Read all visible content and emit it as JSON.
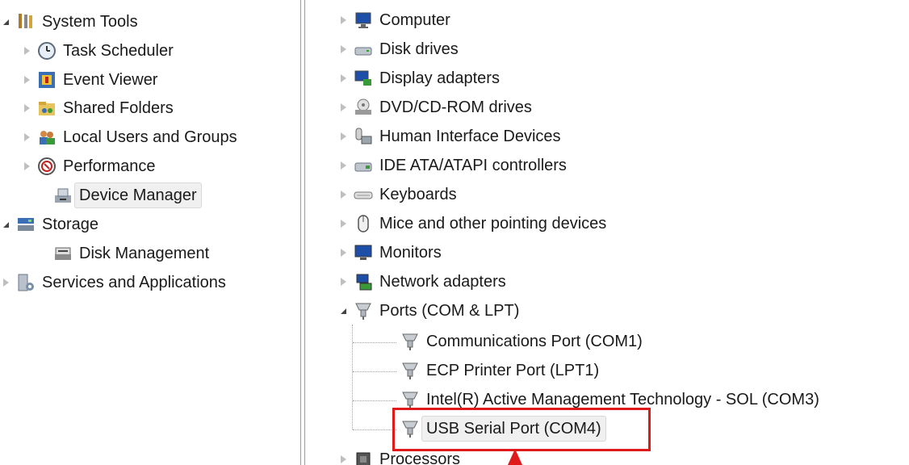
{
  "left_tree": {
    "items": [
      {
        "label": "System Tools",
        "icon": "toolbox-icon",
        "state": "expanded"
      },
      {
        "label": "Task Scheduler",
        "icon": "clock-icon",
        "state": "collapsed"
      },
      {
        "label": "Event Viewer",
        "icon": "event-viewer-icon",
        "state": "collapsed"
      },
      {
        "label": "Shared Folders",
        "icon": "shared-folder-icon",
        "state": "collapsed"
      },
      {
        "label": "Local Users and Groups",
        "icon": "users-icon",
        "state": "collapsed"
      },
      {
        "label": "Performance",
        "icon": "performance-icon",
        "state": "collapsed"
      },
      {
        "label": "Device Manager",
        "icon": "device-manager-icon",
        "state": "none",
        "selected": true
      },
      {
        "label": "Storage",
        "icon": "storage-icon",
        "state": "expanded"
      },
      {
        "label": "Disk Management",
        "icon": "disk-management-icon",
        "state": "none"
      },
      {
        "label": "Services and Applications",
        "icon": "services-icon",
        "state": "collapsed"
      }
    ]
  },
  "device_tree": {
    "items": [
      {
        "label": "Computer",
        "icon": "computer-icon",
        "state": "collapsed"
      },
      {
        "label": "Disk drives",
        "icon": "disk-drive-icon",
        "state": "collapsed"
      },
      {
        "label": "Display adapters",
        "icon": "display-adapter-icon",
        "state": "collapsed"
      },
      {
        "label": "DVD/CD-ROM drives",
        "icon": "dvd-drive-icon",
        "state": "collapsed"
      },
      {
        "label": "Human Interface Devices",
        "icon": "hid-icon",
        "state": "collapsed"
      },
      {
        "label": "IDE ATA/ATAPI controllers",
        "icon": "ide-controller-icon",
        "state": "collapsed"
      },
      {
        "label": "Keyboards",
        "icon": "keyboard-icon",
        "state": "collapsed"
      },
      {
        "label": "Mice and other pointing devices",
        "icon": "mouse-icon",
        "state": "collapsed"
      },
      {
        "label": "Monitors",
        "icon": "monitor-icon",
        "state": "collapsed"
      },
      {
        "label": "Network adapters",
        "icon": "network-adapter-icon",
        "state": "collapsed"
      },
      {
        "label": "Ports (COM & LPT)",
        "icon": "port-icon",
        "state": "expanded"
      },
      {
        "label": "Communications Port (COM1)",
        "icon": "port-icon",
        "state": "none"
      },
      {
        "label": "ECP Printer Port (LPT1)",
        "icon": "port-icon",
        "state": "none"
      },
      {
        "label": "Intel(R) Active Management Technology - SOL (COM3)",
        "icon": "port-icon",
        "state": "none"
      },
      {
        "label": "USB Serial Port (COM4)",
        "icon": "port-icon",
        "state": "none",
        "selected": true
      },
      {
        "label": "Processors",
        "icon": "processor-icon",
        "state": "collapsed"
      }
    ]
  },
  "colors": {
    "highlight_box": "#e01a1a",
    "selection_bg": "#f0f0f0",
    "splitter": "#9d9d9d"
  }
}
